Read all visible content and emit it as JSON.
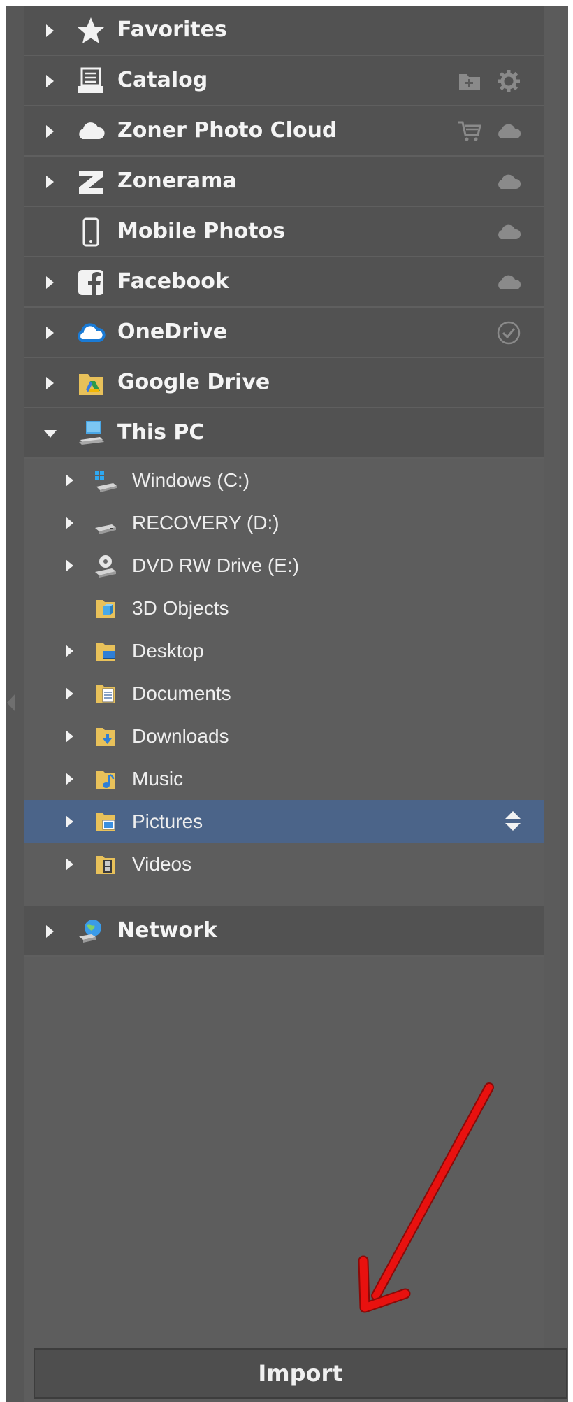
{
  "sections": {
    "favorites": "Favorites",
    "catalog": "Catalog",
    "zoner_cloud": "Zoner Photo Cloud",
    "zonerama": "Zonerama",
    "mobile": "Mobile Photos",
    "facebook": "Facebook",
    "onedrive": "OneDrive",
    "google_drive": "Google Drive",
    "this_pc": "This PC",
    "network": "Network"
  },
  "this_pc_items": {
    "windows_c": "Windows (C:)",
    "recovery_d": "RECOVERY (D:)",
    "dvd_e": "DVD RW Drive (E:)",
    "objects3d": "3D Objects",
    "desktop": "Desktop",
    "documents": "Documents",
    "downloads": "Downloads",
    "music": "Music",
    "pictures": "Pictures",
    "videos": "Videos"
  },
  "selected_item": "Pictures",
  "import_button": "Import",
  "colors": {
    "panel": "#5d5d5d",
    "section_header": "#525252",
    "selected_row": "#4b6489",
    "annotation_arrow": "#e8110f"
  }
}
